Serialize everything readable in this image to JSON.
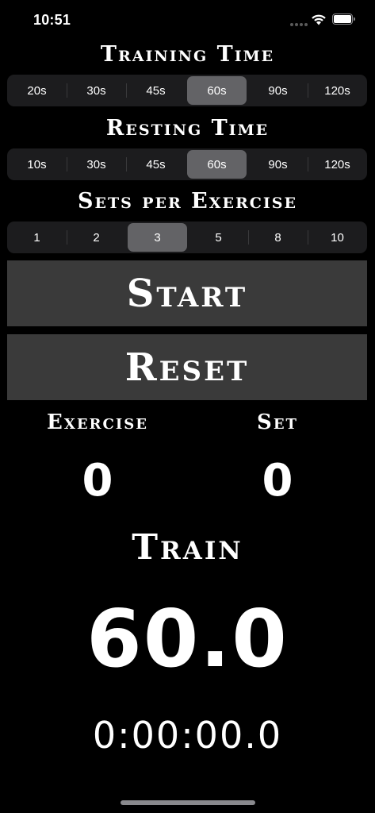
{
  "status_bar": {
    "time": "10:51"
  },
  "training_time": {
    "title": "Training Time",
    "options": [
      "20s",
      "30s",
      "45s",
      "60s",
      "90s",
      "120s"
    ],
    "selected_index": 3
  },
  "resting_time": {
    "title": "Resting Time",
    "options": [
      "10s",
      "30s",
      "45s",
      "60s",
      "90s",
      "120s"
    ],
    "selected_index": 3
  },
  "sets_per_exercise": {
    "title": "Sets per Exercise",
    "options": [
      "1",
      "2",
      "3",
      "5",
      "8",
      "10"
    ],
    "selected_index": 2
  },
  "buttons": {
    "start": "Start",
    "reset": "Reset"
  },
  "counters": {
    "exercise_label": "Exercise",
    "exercise_value": "0",
    "set_label": "Set",
    "set_value": "0"
  },
  "timer": {
    "phase": "Train",
    "countdown": "60.0",
    "elapsed": "0:00:00.0"
  },
  "colors": {
    "background": "#000000",
    "segment_track": "#1c1c1e",
    "segment_selected": "#636366",
    "button_background": "#3a3a3a",
    "text": "#ffffff"
  }
}
